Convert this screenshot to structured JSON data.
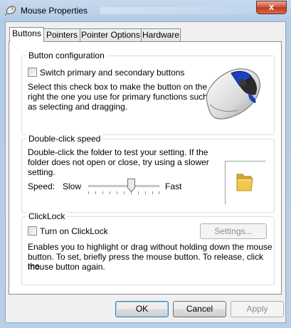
{
  "window": {
    "title": "Mouse Properties",
    "close_glyph": "x"
  },
  "tabs": [
    {
      "label": "Buttons",
      "active": true
    },
    {
      "label": "Pointers",
      "active": false
    },
    {
      "label": "Pointer Options",
      "active": false
    },
    {
      "label": "Hardware",
      "active": false
    }
  ],
  "button_config": {
    "group_label": "Button configuration",
    "checkbox_label": "Switch primary and secondary buttons",
    "checked": false,
    "description_lines": [
      "Select this check box to make the button on the",
      "right the one you use for primary functions such",
      "as selecting and dragging."
    ]
  },
  "double_click": {
    "group_label": "Double-click speed",
    "description_lines": [
      "Double-click the folder to test your setting. If the",
      "folder does not open or close, try using a slower",
      "setting."
    ],
    "speed_label": "Speed:",
    "slow_label": "Slow",
    "fast_label": "Fast",
    "speed_value": 0.6
  },
  "clicklock": {
    "group_label": "ClickLock",
    "checkbox_label": "Turn on ClickLock",
    "checked": false,
    "settings_label": "Settings...",
    "description_lines": [
      "Enables you to highlight or drag without holding down the mouse",
      "button. To set, briefly press the mouse button. To release, click the",
      "mouse button again."
    ]
  },
  "footer": {
    "ok_label": "OK",
    "cancel_label": "Cancel",
    "apply_label": "Apply"
  },
  "colors": {
    "close_red": "#c1391e",
    "mouse_highlight": "#2045c8",
    "folder_yellow": "#f0c94a"
  }
}
